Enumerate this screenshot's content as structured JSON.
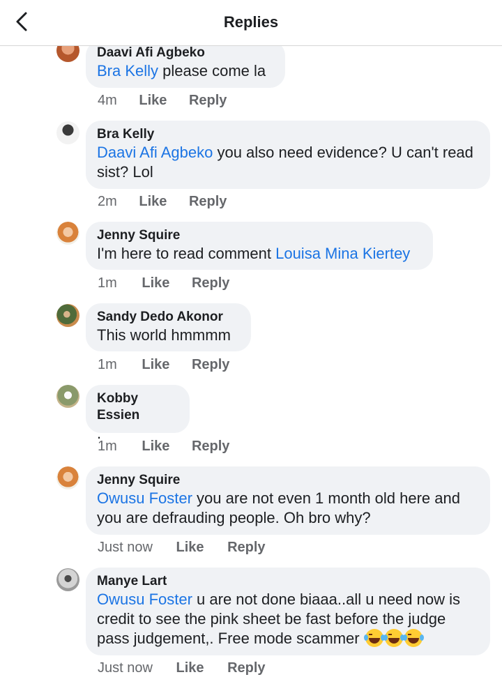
{
  "header": {
    "title": "Replies"
  },
  "comments": [
    {
      "author": "Daavi Afi Agbeko",
      "mention": "Bra Kelly",
      "text": " please come la",
      "time": "4m",
      "like": "Like",
      "reply": "Reply",
      "avatar_color": "#b5572c"
    },
    {
      "author": "Bra Kelly",
      "mention": "Daavi Afi Agbeko",
      "text": " you also need evidence? U can't read sist? Lol",
      "time": "2m",
      "like": "Like",
      "reply": "Reply",
      "avatar_color": "#2b2b2b"
    },
    {
      "author": "Jenny Squire",
      "pre_text": "I'm here to read comment ",
      "mention": "Louisa Mina Kiertey",
      "time": "1m",
      "like": "Like",
      "reply": "Reply",
      "avatar_color": "#d9823b"
    },
    {
      "author": "Sandy Dedo Akonor",
      "text": "This world hmmmm",
      "time": "1m",
      "like": "Like",
      "reply": "Reply",
      "avatar_color": "#4f6b3a"
    },
    {
      "author": "Kobby Essien",
      "text": ".",
      "time": "1m",
      "like": "Like",
      "reply": "Reply",
      "avatar_color": "#8a9a6b"
    },
    {
      "author": "Jenny Squire",
      "mention": "Owusu Foster",
      "text": " you are not even 1 month old here and you are defrauding people. Oh bro why?",
      "time": "Just now",
      "like": "Like",
      "reply": "Reply",
      "avatar_color": "#d9823b"
    },
    {
      "author": "Manye Lart",
      "mention": "Owusu Foster",
      "text": " u are not done biaaa..all u need now is credit to see the pink sheet be fast before the judge pass judgement,. Free mode scammer ",
      "emoji": "face-with-tears-of-joy x3",
      "time": "Just now",
      "like": "Like",
      "reply": "Reply",
      "avatar_color": "#9a9a9a"
    }
  ]
}
